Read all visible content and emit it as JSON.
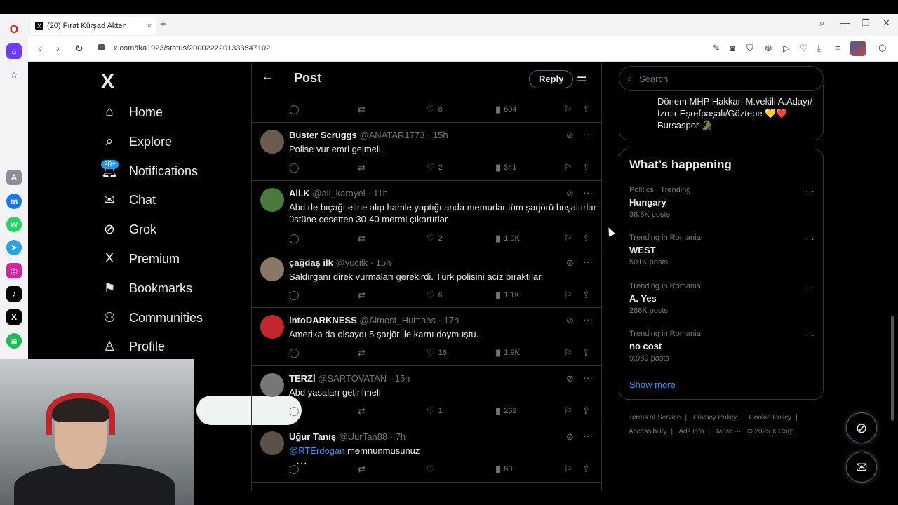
{
  "browser": {
    "tab_title": "(20) Fırat Kürşad Akten",
    "tab_close": "×",
    "new_tab": "+",
    "url": "x.com/fka1923/status/2000222201333547102"
  },
  "nav": {
    "logo": "X",
    "items": [
      {
        "label": "Home",
        "icon": "home-icon"
      },
      {
        "label": "Explore",
        "icon": "search-icon"
      },
      {
        "label": "Notifications",
        "icon": "bell-icon",
        "badge": "20+"
      },
      {
        "label": "Chat",
        "icon": "mail-icon"
      },
      {
        "label": "Grok",
        "icon": "grok-icon"
      },
      {
        "label": "Premium",
        "icon": "x-icon"
      },
      {
        "label": "Bookmarks",
        "icon": "bookmark-icon"
      },
      {
        "label": "Communities",
        "icon": "people-icon"
      },
      {
        "label": "Profile",
        "icon": "person-icon"
      }
    ],
    "more": "···"
  },
  "header": {
    "title": "Post",
    "reply_label": "Reply"
  },
  "top_row": {
    "likes": "8",
    "views": "604"
  },
  "replies": [
    {
      "name": "Buster Scruggs",
      "handle": "@ANATAR1773",
      "time": "15h",
      "text": "Polise vur emri gelmeli.",
      "likes": "2",
      "views": "341",
      "avatar": "#6b5b4e"
    },
    {
      "name": "Ali.K",
      "handle": "@ali_karayel",
      "time": "11h",
      "text": "Abd de bıçağı eline alıp hamle yaptığı anda memurlar tüm şarjörü boşaltırlar üstüne cesetten 30-40 mermi çıkartırlar",
      "likes": "2",
      "views": "1.9K",
      "avatar": "#4c7a3d"
    },
    {
      "name": "çağdaş ilk",
      "handle": "@yucilk",
      "time": "15h",
      "text": "Saldırganı direk vurmaları gerekirdi. Türk polisini aciz bıraktılar.",
      "likes": "6",
      "views": "1.1K",
      "avatar": "#8a7766"
    },
    {
      "name": "intoDARKNESS",
      "handle": "@Almost_Humans",
      "time": "17h",
      "text": "Amerika da olsaydı 5 şarjör ile karnı doymuştu.",
      "likes": "16",
      "views": "1.9K",
      "avatar": "#c1272d"
    },
    {
      "name": "TERZİ",
      "handle": "@SARTOVATAN",
      "time": "15h",
      "text": "Abd yasaları getirilmeli",
      "likes": "1",
      "views": "262",
      "avatar": "#777777"
    },
    {
      "name": "Uğur Tanış",
      "handle": "@UurTan88",
      "time": "7h",
      "mention": "@RTErdogan",
      "text": "memnunmusunuz",
      "likes": "",
      "views": "80",
      "avatar": "#5b5148"
    }
  ],
  "right": {
    "search_placeholder": "Search",
    "bio": "Dönem MHP Hakkari M.vekili A.Adayı/ İzmir Eşrefpaşalı/Göztepe 💛❤️ Bursaspor 🐊",
    "happening_title": "What’s happening",
    "trends": [
      {
        "context": "Politics · Trending",
        "name": "Hungary",
        "count": "38.8K posts"
      },
      {
        "context": "Trending in Romania",
        "name": "WEST",
        "count": "501K posts"
      },
      {
        "context": "Trending in Romania",
        "name": "A. Yes",
        "count": "286K posts"
      },
      {
        "context": "Trending in Romania",
        "name": "no cost",
        "count": "9,989 posts"
      }
    ],
    "show_more": "Show more",
    "footer": [
      "Terms of Service",
      "Privacy Policy",
      "Cookie Policy",
      "Accessibility",
      "Ads info",
      "More ···",
      "© 2025 X Corp."
    ]
  }
}
